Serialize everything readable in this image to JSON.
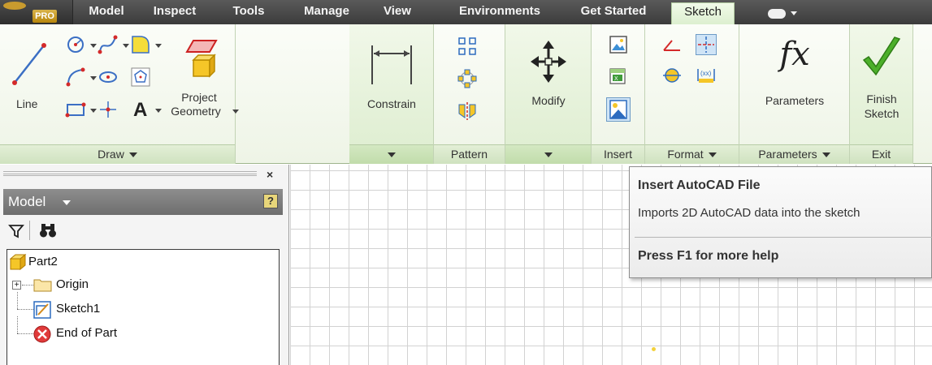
{
  "app": {
    "edition_badge": "PRO"
  },
  "menu_tabs": [
    {
      "label": "Model"
    },
    {
      "label": "Inspect"
    },
    {
      "label": "Tools"
    },
    {
      "label": "Manage"
    },
    {
      "label": "View"
    },
    {
      "label": "Environments"
    },
    {
      "label": "Get Started"
    },
    {
      "label": "Sketch",
      "active": true
    }
  ],
  "ribbon": {
    "draw": {
      "footer": "Draw",
      "line_label": "Line",
      "text_glyph": "A"
    },
    "project_geometry": {
      "label_line1": "Project",
      "label_line2": "Geometry"
    },
    "constrain": {
      "label": "Constrain"
    },
    "pattern": {
      "footer": "Pattern"
    },
    "modify": {
      "label": "Modify"
    },
    "insert": {
      "footer": "Insert"
    },
    "format": {
      "footer": "Format"
    },
    "parameters": {
      "label": "Parameters",
      "footer": "Parameters",
      "fx_glyph": "fx"
    },
    "exit": {
      "label_line1": "Finish",
      "label_line2": "Sketch",
      "footer": "Exit"
    }
  },
  "browser": {
    "close_glyph": "×",
    "title": "Model",
    "help_glyph": "?",
    "tree": [
      {
        "label": "Part2",
        "icon": "part-icon"
      },
      {
        "label": "Origin",
        "icon": "folder-icon",
        "expandable": true
      },
      {
        "label": "Sketch1",
        "icon": "sketch-icon"
      },
      {
        "label": "End of Part",
        "icon": "end-of-part-icon"
      }
    ]
  },
  "tooltip": {
    "title": "Insert AutoCAD File",
    "description": "Imports 2D AutoCAD data into the sketch",
    "help": "Press F1 for more help"
  },
  "colors": {
    "ribbon_bg": "#eef4e6",
    "tab_bar": "#3b3b3b",
    "active_tab": "#dcefd0",
    "finish_check": "#4caf2a",
    "grid_line": "#d2d2d2"
  }
}
